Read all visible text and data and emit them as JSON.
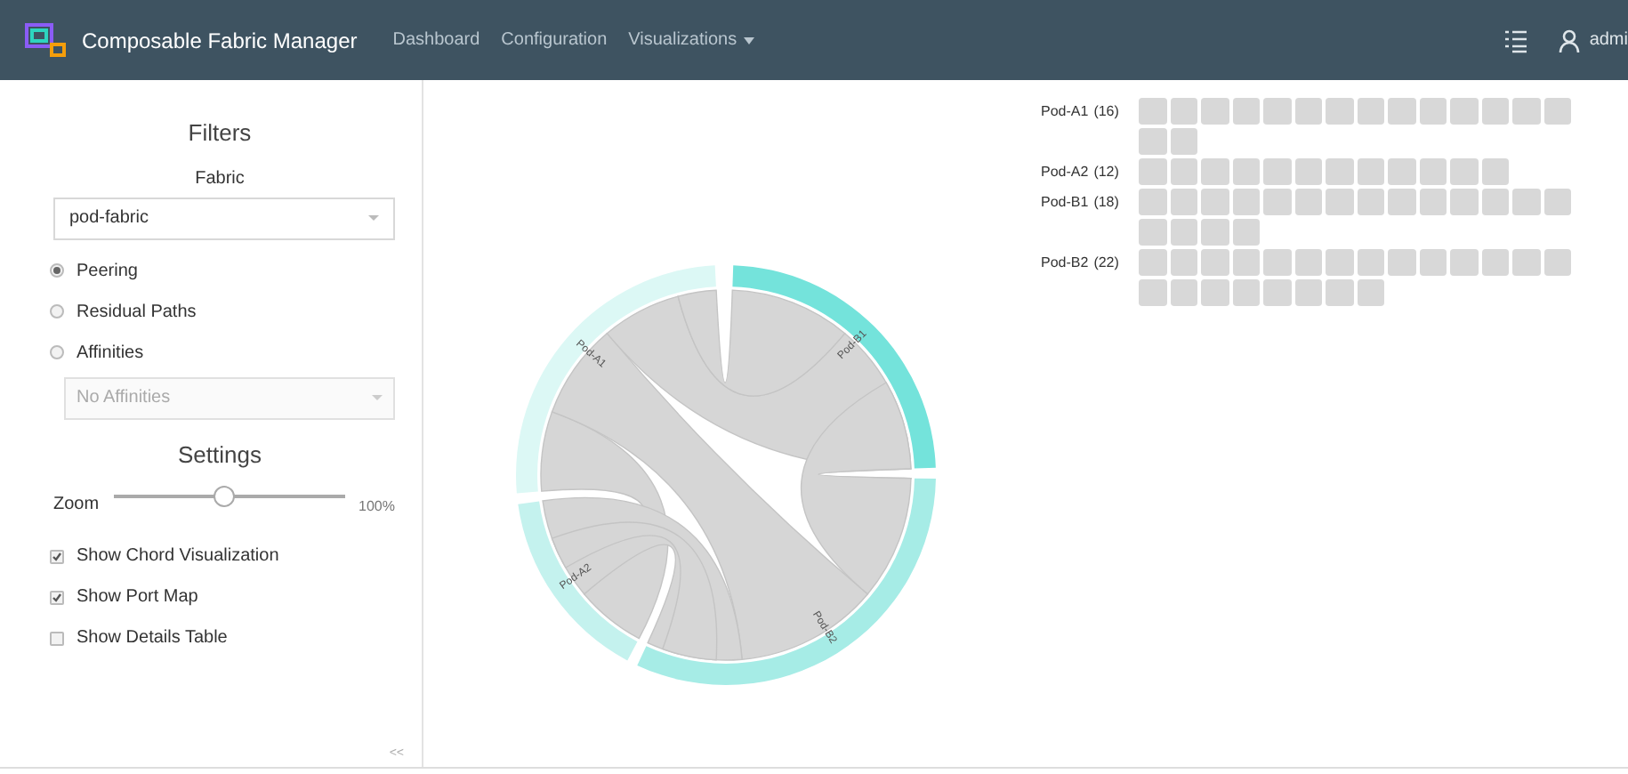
{
  "navbar": {
    "app_title": "Composable Fabric Manager",
    "links": [
      {
        "label": "Dashboard",
        "dropdown": false
      },
      {
        "label": "Configuration",
        "dropdown": false
      },
      {
        "label": "Visualizations",
        "dropdown": true
      }
    ],
    "user": "admi"
  },
  "sidebar": {
    "filters_title": "Filters",
    "fabric_label": "Fabric",
    "fabric_value": "pod-fabric",
    "modes": [
      {
        "label": "Peering",
        "selected": true
      },
      {
        "label": "Residual Paths",
        "selected": false
      },
      {
        "label": "Affinities",
        "selected": false
      }
    ],
    "affinities_value": "No Affinities",
    "settings_title": "Settings",
    "zoom_label": "Zoom",
    "zoom": {
      "level": 0.48
    },
    "zoom_reading": "100%",
    "options": [
      {
        "label": "Show Chord Visualization",
        "checked": true
      },
      {
        "label": "Show Port Map",
        "checked": true
      },
      {
        "label": "Show Details Table",
        "checked": false
      }
    ],
    "collapse": "<<"
  },
  "chord": {
    "groups": [
      {
        "label": "Pod-A1",
        "color": "#dcf8f5"
      },
      {
        "label": "Pod-B1",
        "color": "#74e3db"
      },
      {
        "label": "Pod-B2",
        "color": "#a6ece6"
      },
      {
        "label": "Pod-A2",
        "color": "#c4f2ee"
      }
    ]
  },
  "port_map": [
    {
      "name": "Pod-A1",
      "count": "(16)"
    },
    {
      "name": "Pod-A2",
      "count": "(12)"
    },
    {
      "name": "Pod-B1",
      "count": "(18)"
    },
    {
      "name": "Pod-B2",
      "count": "(22)"
    }
  ]
}
